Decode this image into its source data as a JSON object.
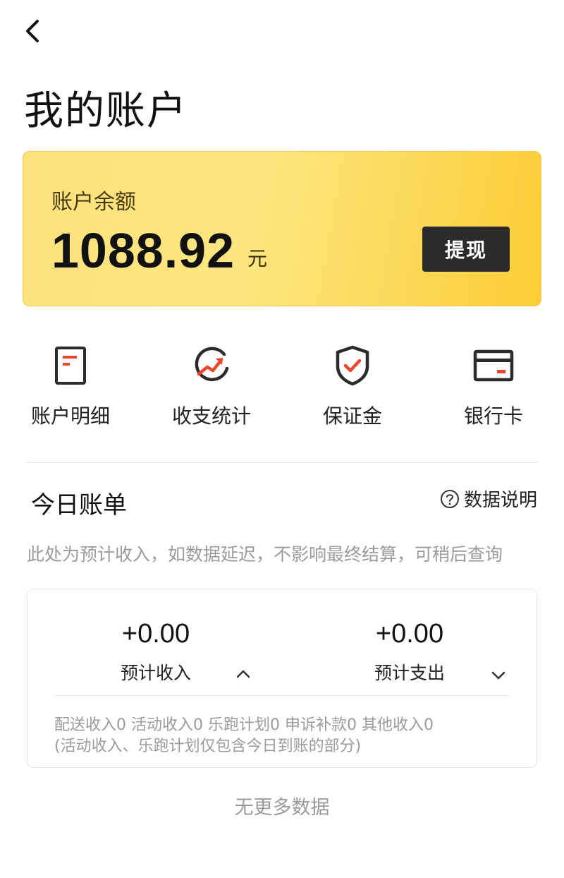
{
  "header": {
    "title": "我的账户"
  },
  "balance": {
    "label": "账户余额",
    "amount": "1088.92",
    "unit": "元",
    "withdraw_label": "提现"
  },
  "quick_actions": [
    {
      "label": "账户明细",
      "icon": "document-icon"
    },
    {
      "label": "收支统计",
      "icon": "trend-chart-icon"
    },
    {
      "label": "保证金",
      "icon": "shield-check-icon"
    },
    {
      "label": "银行卡",
      "icon": "bank-card-icon"
    }
  ],
  "today_bill": {
    "title": "今日账单",
    "explain_label": "数据说明",
    "notice": "此处为预计收入，如数据延迟，不影响最终结算，可稍后查询",
    "income": {
      "value": "+0.00",
      "label": "预计收入"
    },
    "expense": {
      "value": "+0.00",
      "label": "预计支出"
    },
    "detail_line1": "配送收入0 活动收入0 乐跑计划0 申诉补款0 其他收入0",
    "detail_line2": "(活动收入、乐跑计划仅包含今日到账的部分)"
  },
  "footer": {
    "no_more": "无更多数据"
  },
  "colors": {
    "accent_red": "#e8492b",
    "card_yellow": "#fde27e",
    "button_dark": "#2b2b2b"
  }
}
